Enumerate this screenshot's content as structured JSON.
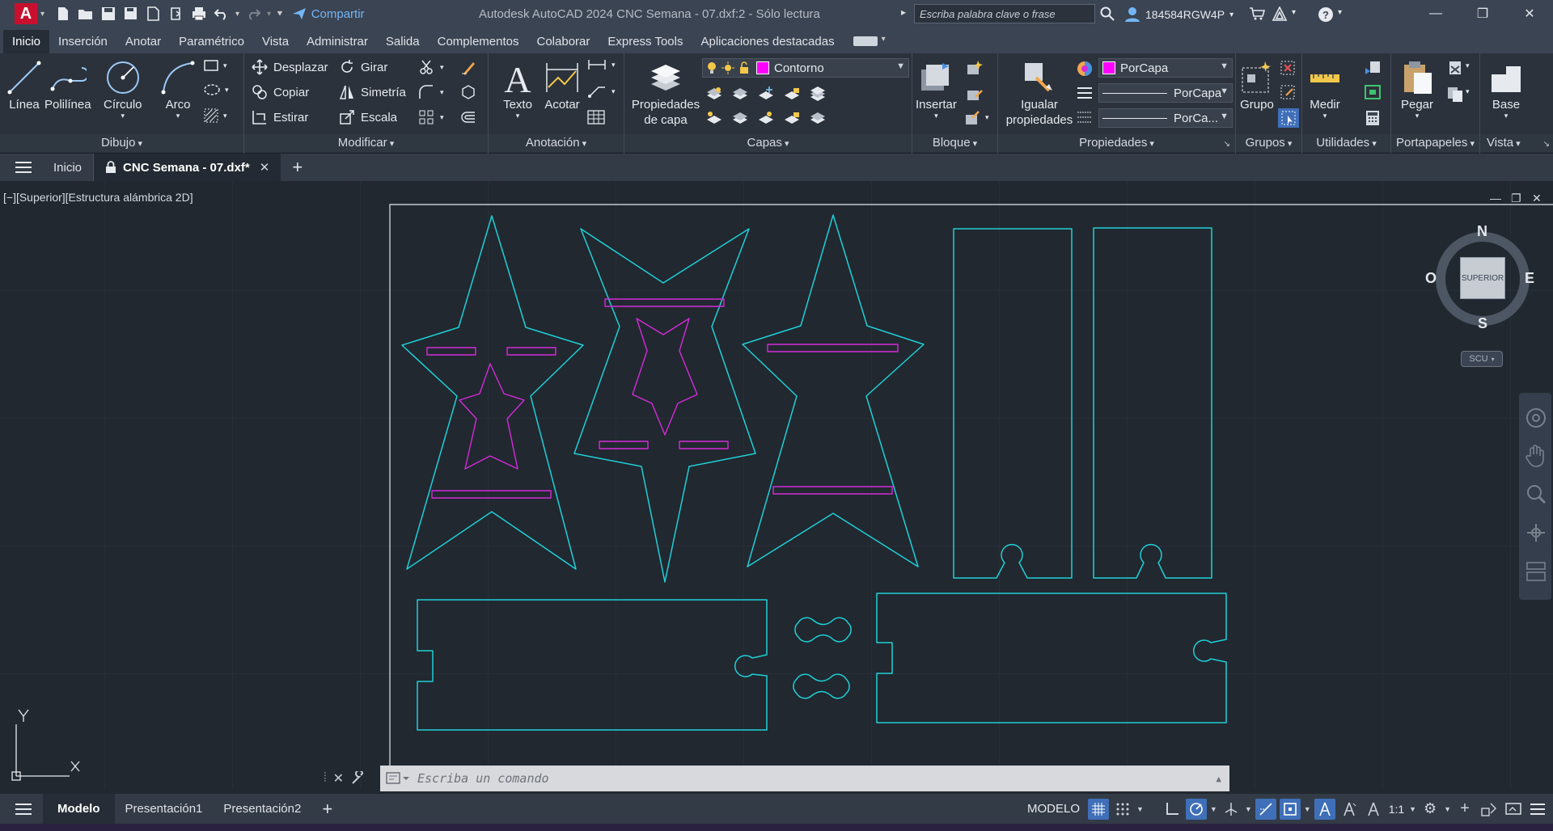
{
  "titlebar": {
    "app_letter": "A",
    "share_label": "Compartir",
    "title": "Autodesk AutoCAD 2024    CNC Semana - 07.dxf:2 - Sólo lectura",
    "search_placeholder": "Escriba palabra clave o frase",
    "username": "184584RGW4P"
  },
  "ribbon_tabs": [
    "Inicio",
    "Inserción",
    "Anotar",
    "Paramétrico",
    "Vista",
    "Administrar",
    "Salida",
    "Complementos",
    "Colaborar",
    "Express Tools",
    "Aplicaciones destacadas"
  ],
  "ribbon": {
    "draw": {
      "label": "Dibujo",
      "tools": [
        "Línea",
        "Polilínea",
        "Círculo",
        "Arco"
      ]
    },
    "modify": {
      "label": "Modificar",
      "tools": [
        "Desplazar",
        "Girar",
        "Copiar",
        "Simetría",
        "Estirar",
        "Escala"
      ]
    },
    "annotation": {
      "label": "Anotación",
      "tools": [
        "Texto",
        "Acotar"
      ]
    },
    "layers": {
      "label": "Capas",
      "layer_props": "Propiedades de capa",
      "current_layer": "Contorno"
    },
    "block": {
      "label": "Bloque",
      "insert": "Insertar"
    },
    "properties": {
      "label": "Propiedades",
      "match": "Igualar propiedades",
      "color": "PorCapa",
      "linetype": "PorCapa",
      "lineweight": "PorCa..."
    },
    "groups": {
      "label": "Grupos",
      "group": "Grupo"
    },
    "utilities": {
      "label": "Utilidades",
      "measure": "Medir"
    },
    "clipboard": {
      "label": "Portapapeles",
      "paste": "Pegar"
    },
    "view": {
      "label": "Vista",
      "base": "Base"
    }
  },
  "file_tabs": {
    "home": "Inicio",
    "active": "CNC Semana - 07.dxf*"
  },
  "viewport": {
    "label": "[−][Superior][Estructura alámbrica 2D]",
    "viewcube": {
      "n": "N",
      "s": "S",
      "e": "E",
      "w": "O",
      "face": "SUPERIOR",
      "ucs": "SCU"
    },
    "ucs_y": "Y"
  },
  "command": {
    "placeholder": "Escriba un comando"
  },
  "status": {
    "layout_tabs": [
      "Modelo",
      "Presentación1",
      "Presentación2"
    ],
    "space": "MODELO",
    "scale": "1:1"
  },
  "colors": {
    "cyan": "#1fcfd6",
    "magenta": "#d62ad9",
    "accent": "#3f6fb8"
  }
}
